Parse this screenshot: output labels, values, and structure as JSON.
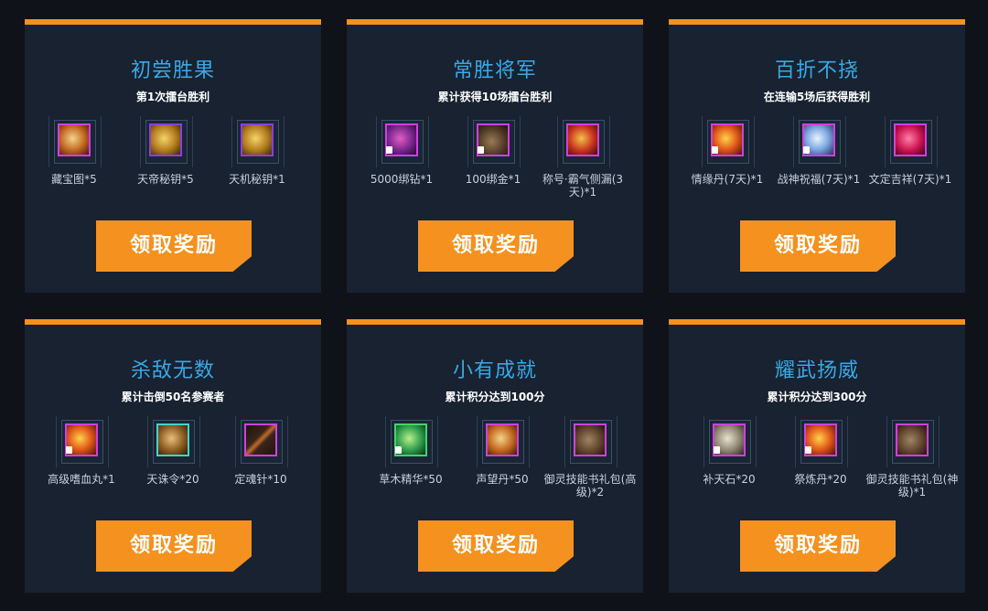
{
  "cards": [
    {
      "title": "初尝胜果",
      "subtitle": "第1次擂台胜利",
      "button": "领取奖励",
      "items": [
        {
          "label": "藏宝图*5",
          "icon": "treasure-map-icon",
          "lock": false
        },
        {
          "label": "天帝秘钥*5",
          "icon": "golden-key-icon",
          "lock": false
        },
        {
          "label": "天机秘钥*1",
          "icon": "bronze-key-icon",
          "lock": false
        }
      ]
    },
    {
      "title": "常胜将军",
      "subtitle": "累计获得10场擂台胜利",
      "button": "领取奖励",
      "items": [
        {
          "label": "5000绑钻*1",
          "icon": "diamond-chest-icon",
          "lock": true
        },
        {
          "label": "100绑金*1",
          "icon": "gold-bag-icon",
          "lock": true
        },
        {
          "label": "称号·霸气侧漏(3天)*1",
          "icon": "title-badge-icon",
          "lock": false
        }
      ]
    },
    {
      "title": "百折不挠",
      "subtitle": "在连输5场后获得胜利",
      "button": "领取奖励",
      "items": [
        {
          "label": "情缘丹(7天)*1",
          "icon": "fire-pill-icon",
          "lock": true
        },
        {
          "label": "战神祝福(7天)*1",
          "icon": "ice-blessing-icon",
          "lock": true
        },
        {
          "label": "文定吉祥(7天)*1",
          "icon": "heart-token-icon",
          "lock": false
        }
      ]
    },
    {
      "title": "杀敌无数",
      "subtitle": "累计击倒50名参赛者",
      "button": "领取奖励",
      "items": [
        {
          "label": "高级嗜血丸*1",
          "icon": "blood-pill-icon",
          "lock": true
        },
        {
          "label": "天诛令*20",
          "icon": "scroll-token-icon",
          "lock": false
        },
        {
          "label": "定魂针*10",
          "icon": "needle-icon",
          "lock": false
        }
      ]
    },
    {
      "title": "小有成就",
      "subtitle": "累计积分达到100分",
      "button": "领取奖励",
      "items": [
        {
          "label": "草木精华*50",
          "icon": "herb-essence-icon",
          "lock": true
        },
        {
          "label": "声望丹*50",
          "icon": "reputation-pill-icon",
          "lock": false
        },
        {
          "label": "御灵技能书礼包(高级)*2",
          "icon": "skill-book-bag-icon",
          "lock": false
        }
      ]
    },
    {
      "title": "耀武扬威",
      "subtitle": "累计积分达到300分",
      "button": "领取奖励",
      "items": [
        {
          "label": "补天石*20",
          "icon": "sky-stone-icon",
          "lock": true
        },
        {
          "label": "祭炼丹*20",
          "icon": "refine-pill-icon",
          "lock": true
        },
        {
          "label": "御灵技能书礼包(神级)*1",
          "icon": "divine-book-bag-icon",
          "lock": false
        }
      ]
    }
  ]
}
